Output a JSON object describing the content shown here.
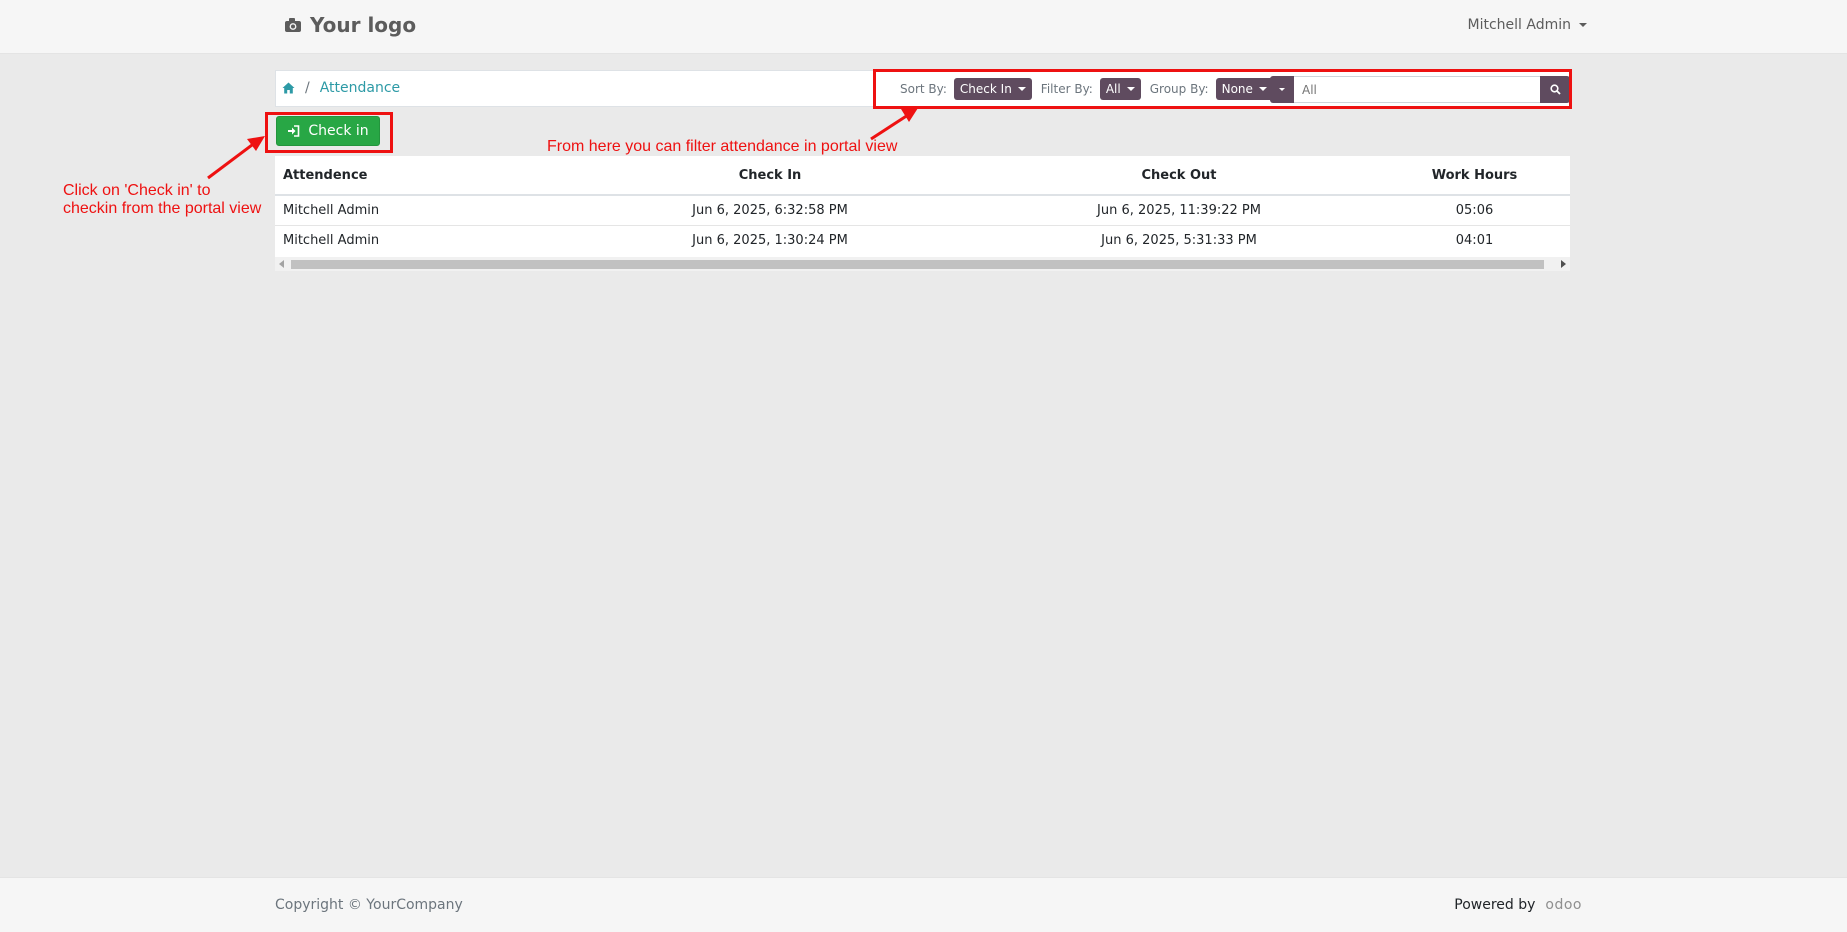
{
  "header": {
    "logo_text": "Your logo",
    "user_name": "Mitchell Admin"
  },
  "breadcrumb": {
    "current": "Attendance"
  },
  "filters": {
    "sort_label": "Sort By:",
    "sort_value": "Check In",
    "filter_label": "Filter By:",
    "filter_value": "All",
    "group_label": "Group By:",
    "group_value": "None",
    "search_value": "All"
  },
  "actions": {
    "checkin_label": "Check in"
  },
  "table": {
    "columns": [
      "Attendence",
      "Check In",
      "Check Out",
      "Work Hours"
    ],
    "rows": [
      [
        "Mitchell Admin",
        "Jun 6, 2025, 6:32:58 PM",
        "Jun 6, 2025, 11:39:22 PM",
        "05:06"
      ],
      [
        "Mitchell Admin",
        "Jun 6, 2025, 1:30:24 PM",
        "Jun 6, 2025, 5:31:33 PM",
        "04:01"
      ]
    ]
  },
  "annotations": {
    "checkin_note_line1": "Click on 'Check in' to",
    "checkin_note_line2": "checkin from the portal view",
    "filter_note": "From here you can filter attendance in portal view"
  },
  "footer": {
    "copyright": "Copyright © YourCompany",
    "powered_by": "Powered by",
    "brand": "odoo"
  },
  "colors": {
    "accent": "#5f4b5f",
    "success": "#28a745",
    "link": "#2d9aa6",
    "annotation": "#ee1111"
  },
  "icons": {
    "logo": "camera-icon",
    "home": "home-icon",
    "checkin": "sign-in-icon",
    "search": "search-icon"
  }
}
